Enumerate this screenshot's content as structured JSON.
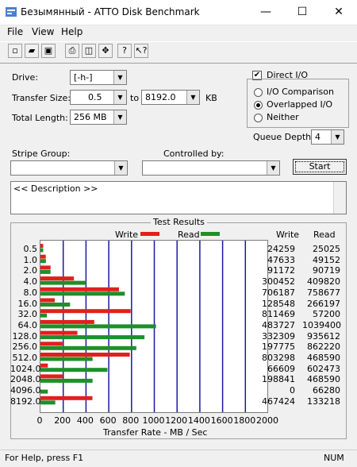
{
  "window": {
    "title": "Безымянный - ATTO Disk Benchmark",
    "minimize": "—",
    "maximize": "☐",
    "close": "✕"
  },
  "menu": [
    "File",
    "View",
    "Help"
  ],
  "form": {
    "drive_label": "Drive:",
    "drive_value": "[-h-]",
    "transfer_size_label": "Transfer Size:",
    "transfer_from": "0.5",
    "transfer_to_label": "to",
    "transfer_to": "8192.0",
    "transfer_unit": "KB",
    "total_length_label": "Total Length:",
    "total_length": "256 MB",
    "direct_io_label": "Direct I/O",
    "io_comparison_label": "I/O Comparison",
    "overlapped_io_label": "Overlapped I/O",
    "neither_label": "Neither",
    "queue_depth_label": "Queue Depth:",
    "queue_depth": "4",
    "stripe_group_label": "Stripe Group:",
    "controlled_by_label": "Controlled by:",
    "start_label": "Start",
    "description": "<< Description >>"
  },
  "results": {
    "title": "Test Results",
    "legend_write": "Write",
    "legend_read": "Read",
    "col_write": "Write",
    "col_read": "Read",
    "xlabel": "Transfer Rate - MB / Sec",
    "colors": {
      "write": "#e0201c",
      "read": "#1f8f2a",
      "grid": "#1a1aa0"
    }
  },
  "chart_data": {
    "type": "bar",
    "categories": [
      "0.5",
      "1.0",
      "2.0",
      "4.0",
      "8.0",
      "16.0",
      "32.0",
      "64.0",
      "128.0",
      "256.0",
      "512.0",
      "1024.0",
      "2048.0",
      "4096.0",
      "8192.0"
    ],
    "series": [
      {
        "name": "Write",
        "values": [
          24259,
          47633,
          91172,
          300452,
          706187,
          128548,
          811469,
          483727,
          332309,
          197775,
          803298,
          66609,
          198841,
          0,
          467424
        ]
      },
      {
        "name": "Read",
        "values": [
          25025,
          49152,
          90719,
          409820,
          758677,
          266197,
          57200,
          1039400,
          935612,
          862220,
          468590,
          602473,
          468590,
          66280,
          133218
        ]
      }
    ],
    "xlabel": "Transfer Rate - MB / Sec",
    "xticks": [
      "0",
      "200",
      "400",
      "600",
      "800",
      "1000",
      "1200",
      "1400",
      "1600",
      "1800",
      "2000"
    ],
    "xlim": [
      0,
      2000
    ],
    "grid": true
  },
  "status": {
    "text": "For Help, press F1",
    "indicator": "NUM"
  }
}
